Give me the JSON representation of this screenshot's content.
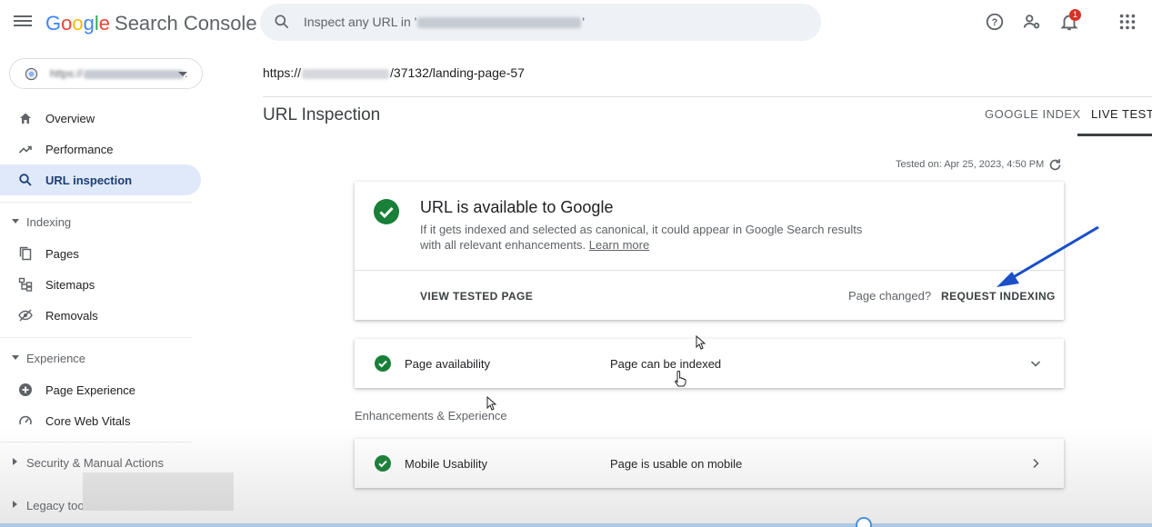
{
  "app": {
    "logo_parts": [
      "G",
      "o",
      "o",
      "g",
      "l",
      "e"
    ],
    "product": "Search Console"
  },
  "search": {
    "placeholder_prefix": "Inspect any URL in '",
    "placeholder_suffix": "'"
  },
  "header": {
    "notification_count": "1"
  },
  "property_selector": {
    "visible_text": "https://",
    "truncation": "."
  },
  "sidebar": {
    "items_top": [
      {
        "label": "Overview",
        "icon": "home-icon"
      },
      {
        "label": "Performance",
        "icon": "trending-up-icon"
      },
      {
        "label": "URL inspection",
        "icon": "search-icon",
        "active": true
      }
    ],
    "sections": [
      {
        "label": "Indexing",
        "expanded": true,
        "items": [
          {
            "label": "Pages",
            "icon": "pages-icon"
          },
          {
            "label": "Sitemaps",
            "icon": "sitemap-icon"
          },
          {
            "label": "Removals",
            "icon": "eye-off-icon"
          }
        ]
      },
      {
        "label": "Experience",
        "expanded": true,
        "items": [
          {
            "label": "Page Experience",
            "icon": "plus-circle-icon"
          },
          {
            "label": "Core Web Vitals",
            "icon": "speed-icon"
          }
        ]
      },
      {
        "label": "Security & Manual Actions",
        "expanded": false,
        "items": []
      },
      {
        "label": "Legacy too",
        "expanded": false,
        "items": []
      }
    ]
  },
  "main": {
    "url_prefix": "https://",
    "url_suffix": "/37132/landing-page-57",
    "title": "URL Inspection",
    "tabs": [
      {
        "label": "GOOGLE INDEX",
        "active": false
      },
      {
        "label": "LIVE TEST",
        "active": true
      }
    ],
    "tested_on": "Tested on: Apr 25, 2023, 4:50 PM",
    "status_card": {
      "title": "URL is available to Google",
      "desc": "If it gets indexed and selected as canonical, it could appear in Google Search results with all relevant enhancements.",
      "learn_more": "Learn more",
      "view_tested_page": "VIEW TESTED PAGE",
      "page_changed": "Page changed?",
      "request_indexing": "REQUEST INDEXING"
    },
    "availability_row": {
      "label": "Page availability",
      "status": "Page can be indexed"
    },
    "enhancements_caption": "Enhancements & Experience",
    "mobile_row": {
      "label": "Mobile Usability",
      "status": "Page is usable on mobile"
    }
  },
  "colors": {
    "accent": "#1a73e8",
    "success": "#188038",
    "active_nav_bg": "#e0e9f9",
    "badge": "#d93025",
    "annotation_arrow": "#1a4fc7"
  }
}
